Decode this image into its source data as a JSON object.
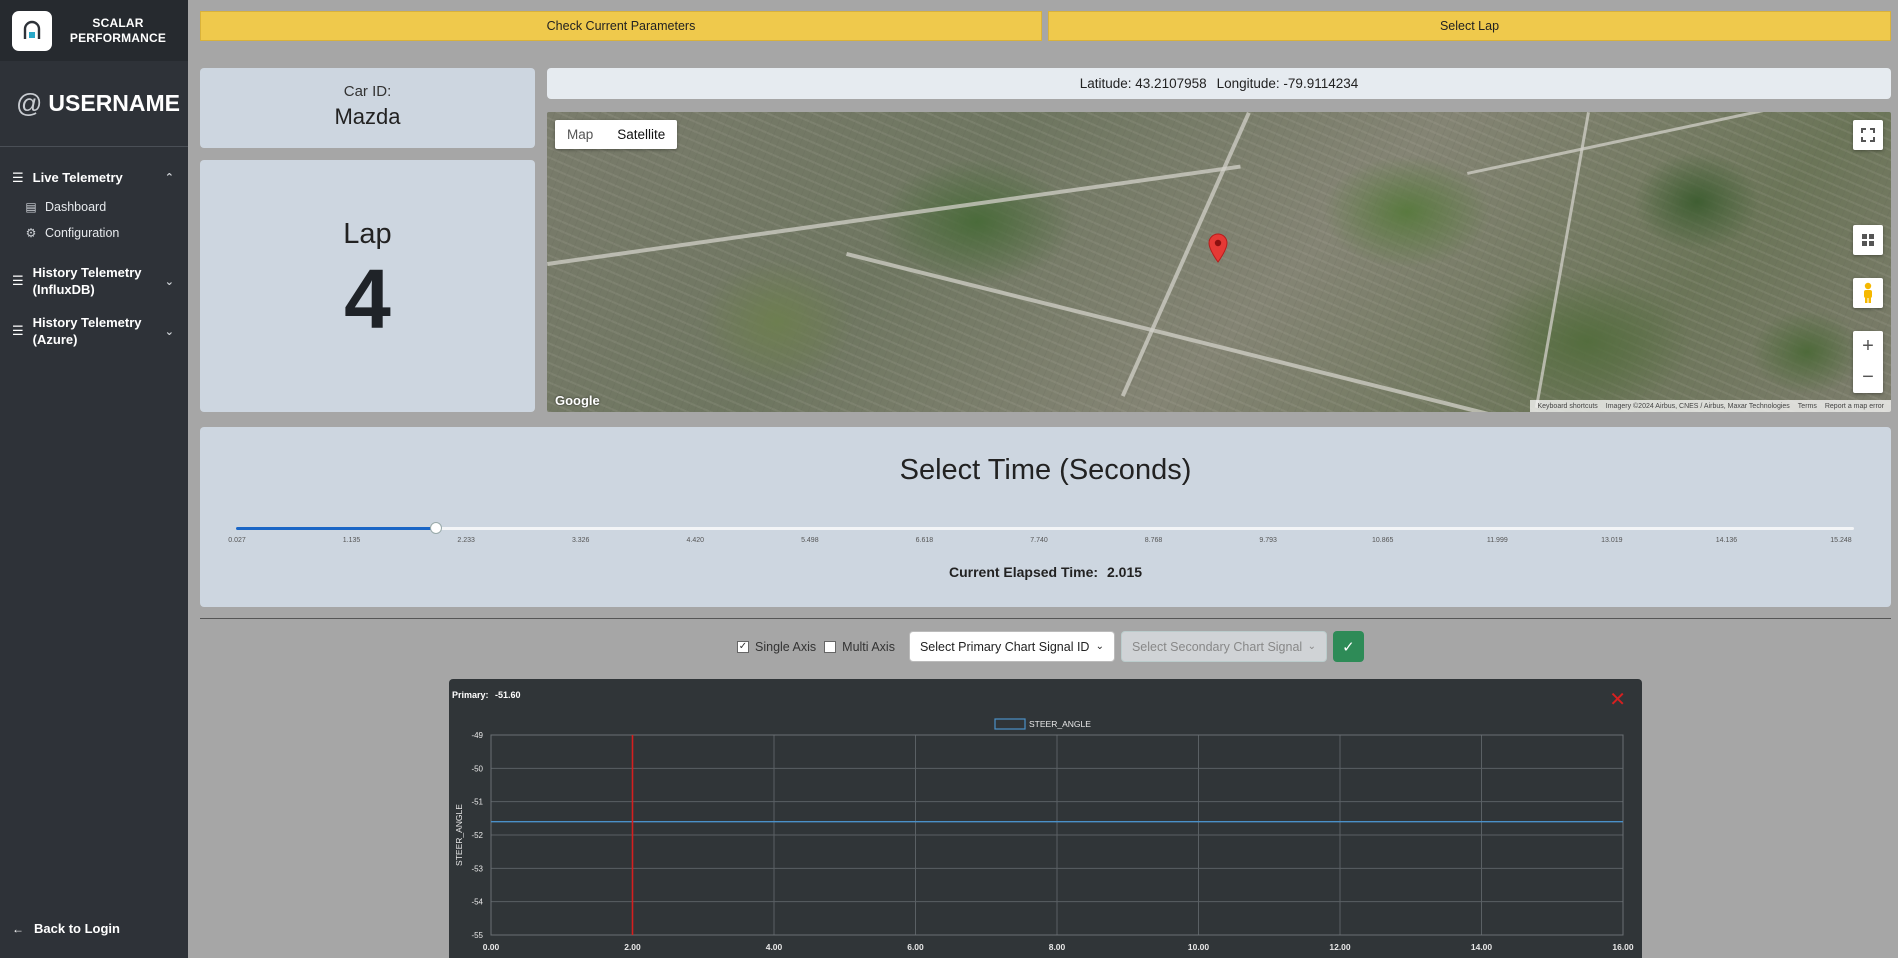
{
  "brand": {
    "name_line1": "SCALAR",
    "name_line2": "PERFORMANCE"
  },
  "user": {
    "at": "@",
    "name": "USERNAME"
  },
  "sidebar": {
    "groups": [
      {
        "label": "Live Telemetry",
        "chevron": "up"
      },
      {
        "label": "History Telemetry (InfluxDB)",
        "chevron": "down"
      },
      {
        "label": "History Telemetry (Azure)",
        "chevron": "down"
      }
    ],
    "sub_items": [
      {
        "label": "Dashboard",
        "icon": "calendar-icon"
      },
      {
        "label": "Configuration",
        "icon": "gear-icon"
      }
    ],
    "logout": "Back to Login"
  },
  "toolbar": {
    "check_params": "Check Current Parameters",
    "select_lap": "Select Lap"
  },
  "car": {
    "label": "Car ID:",
    "value": "Mazda"
  },
  "lap": {
    "label": "Lap",
    "value": "4"
  },
  "coords": {
    "latitude": "Latitude: 43.2107958",
    "longitude": "Longitude: -79.9114234"
  },
  "map": {
    "tab_map": "Map",
    "tab_satellite": "Satellite",
    "active_tab": "Satellite",
    "logo": "Google",
    "attribution": [
      "Keyboard shortcuts",
      "Imagery ©2024 Airbus, CNES / Airbus, Maxar Technologies",
      "Terms",
      "Report a map error"
    ],
    "zoom_in": "+",
    "zoom_out": "−"
  },
  "time": {
    "title": "Select Time (Seconds)",
    "ticks": [
      "0.027",
      "1.135",
      "2.233",
      "3.326",
      "4.420",
      "5.498",
      "6.618",
      "7.740",
      "8.768",
      "9.793",
      "10.865",
      "11.999",
      "13.019",
      "14.136",
      "15.248"
    ],
    "min": 0.027,
    "max": 16.12,
    "value": 2.015,
    "elapsed_label": "Current Elapsed Time:",
    "elapsed_value": "2.015"
  },
  "controls": {
    "single_axis": "Single Axis",
    "single_checked": true,
    "multi_axis": "Multi Axis",
    "multi_checked": false,
    "primary_placeholder": "Select Primary Chart Signal ID",
    "secondary_placeholder": "Select Secondary Chart Signal ID"
  },
  "chart_header": {
    "primary_label": "Primary:",
    "primary_value": "-51.60"
  },
  "chart_data": {
    "type": "line",
    "title": "",
    "xlabel": "",
    "ylabel": "STEER_ANGLE",
    "xlim": [
      0,
      16
    ],
    "ylim": [
      -55,
      -49
    ],
    "x_ticks": [
      "0.00",
      "2.00",
      "4.00",
      "6.00",
      "8.00",
      "10.00",
      "12.00",
      "14.00",
      "16.00"
    ],
    "y_ticks": [
      "-49",
      "-50",
      "-51",
      "-52",
      "-53",
      "-54",
      "-55"
    ],
    "grid": true,
    "legend": "top-center",
    "cursor_x": 2.0,
    "series": [
      {
        "name": "STEER_ANGLE",
        "color": "#4a90c8",
        "x": [
          0,
          16
        ],
        "y": [
          -51.6,
          -51.6
        ]
      }
    ]
  }
}
